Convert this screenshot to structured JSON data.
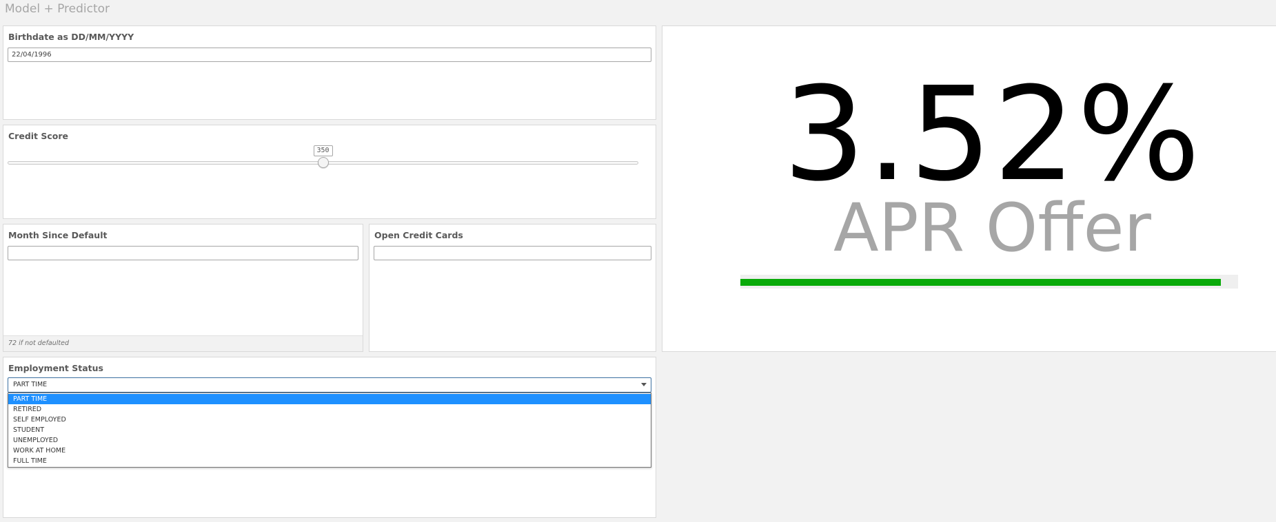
{
  "app": {
    "title": "Model + Predictor"
  },
  "birthdate": {
    "label": "Birthdate as DD/MM/YYYY",
    "value": "22/04/1996"
  },
  "credit_score": {
    "label": "Credit Score",
    "value": "350",
    "fraction": 0.5
  },
  "months_since_default": {
    "label": "Month Since Default",
    "value": "",
    "hint": "72 if not defaulted"
  },
  "open_credit_cards": {
    "label": "Open Credit Cards",
    "value": ""
  },
  "employment_status": {
    "label": "Employment Status",
    "selected": "PART TIME",
    "options": [
      "PART TIME",
      "RETIRED",
      "SELF EMPLOYED",
      "STUDENT",
      "UNEMPLOYED",
      "WORK AT HOME",
      "FULL TIME"
    ]
  },
  "apr": {
    "value": "3.52%",
    "label": "APR Offer",
    "gauge_fraction": 0.965,
    "gauge_color": "#0aaa0a"
  }
}
